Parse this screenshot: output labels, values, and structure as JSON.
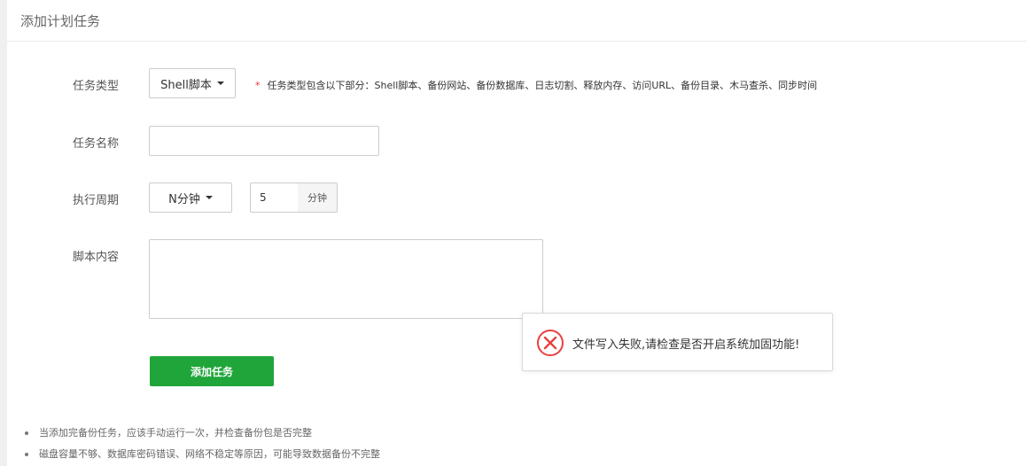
{
  "header": {
    "title": "添加计划任务"
  },
  "form": {
    "task_type": {
      "label": "任务类型",
      "selected": "Shell脚本",
      "hint_star": "*",
      "hint": "任务类型包含以下部分：Shell脚本、备份网站、备份数据库、日志切割、释放内存、访问URL、备份目录、木马查杀、同步时间"
    },
    "task_name": {
      "label": "任务名称",
      "value": "",
      "placeholder": ""
    },
    "period": {
      "label": "执行周期",
      "selected": "N分钟",
      "value": "5",
      "unit": "分钟"
    },
    "script": {
      "label": "脚本内容",
      "value": ""
    },
    "submit_label": "添加任务"
  },
  "toast": {
    "message": "文件写入失败,请检查是否开启系统加固功能!",
    "icon": "error-circle-icon",
    "color": "#e8423f"
  },
  "notes": [
    "当添加完备份任务，应该手动运行一次，并检查备份包是否完整",
    "磁盘容量不够、数据库密码错误、网络不稳定等原因，可能导致数据备份不完整"
  ],
  "colors": {
    "primary": "#20a53a",
    "required": "#e33333",
    "error": "#e8423f"
  }
}
